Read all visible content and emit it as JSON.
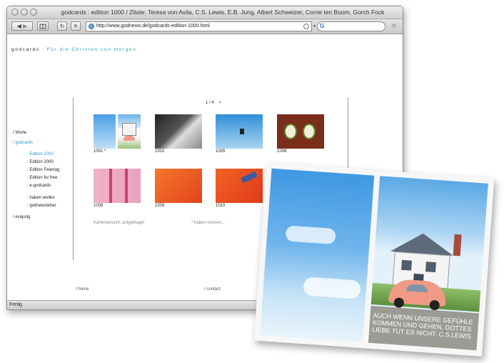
{
  "window": {
    "title": "godcards : edition 1000 / Zitate: Teresa von Avila, C.S. Lewis, E.B. Jung, Albert Schweizer, Corrie ten Boom, Gorch Fock",
    "url": "http://www.godnews.de/godcards-edition-1000.html",
    "status": "Fertig"
  },
  "site": {
    "logo": "godcards",
    "tagline": ": Für die Christen von morgen.",
    "pager": "1 / 4",
    "pager_next": ">",
    "nav": {
      "worte": "/ Worte",
      "godcards": "/ godcards",
      "sub": [
        ": Edition 1000",
        ": Edition 2000",
        ": Edition Feiertag",
        ": Edition for free",
        ": e-godcards"
      ],
      "sub2": [
        ": haben wollen",
        ": godnewsletter"
      ],
      "evajung": "/ evajung"
    },
    "cards": [
      "1001 *",
      "1002",
      "1005",
      "1006",
      "1008",
      "1009",
      "1010"
    ],
    "note_left": "Kartenansicht: aufgeklappt",
    "note_right": "* haben können...",
    "footer_home": "/ home",
    "footer_contact": "/ contact"
  },
  "card_overlay": {
    "quote_lines": [
      "AUCH WENN UNSERE GEFÜHLE",
      "KOMMEN UND GEHEN, GOTTES",
      "LIEBE TUT ES NICHT. C.S.LEWIS"
    ]
  },
  "colors": {
    "accent": "#2a9bd0",
    "car": "#f09a86",
    "sky": "#4aa3e6"
  },
  "icons": [
    "back-icon",
    "forward-icon",
    "bookmarks-icon",
    "reload-icon",
    "stop-icon",
    "globe-icon",
    "rss-icon",
    "google-icon",
    "spinner-icon"
  ]
}
